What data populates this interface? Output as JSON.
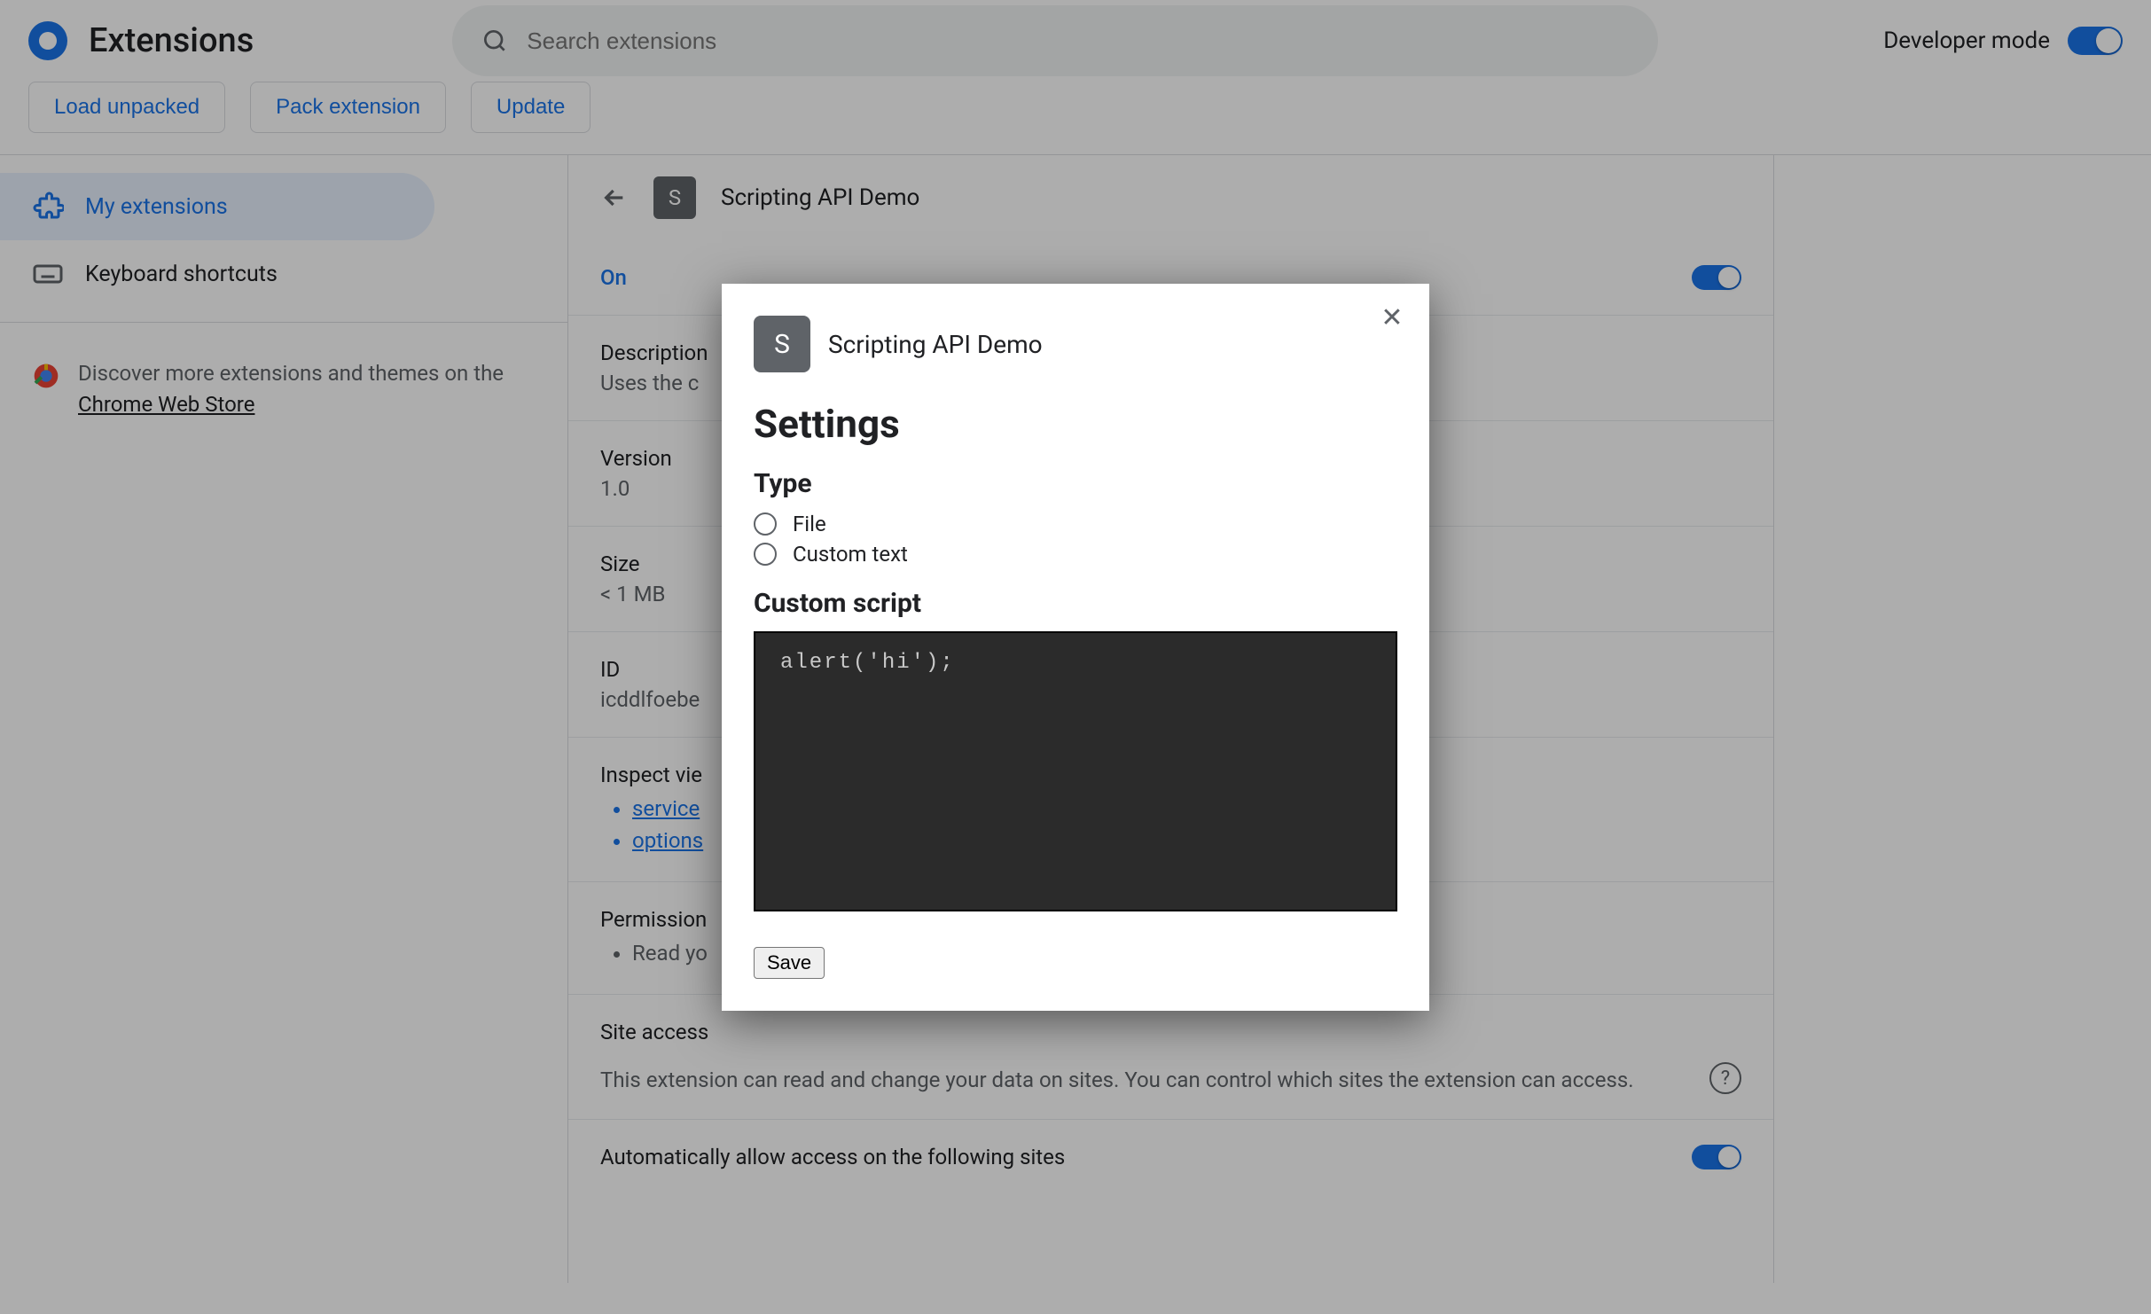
{
  "header": {
    "page_title": "Extensions",
    "search_placeholder": "Search extensions",
    "dev_mode_label": "Developer mode"
  },
  "toolbar": {
    "load_unpacked": "Load unpacked",
    "pack_extension": "Pack extension",
    "update": "Update"
  },
  "sidebar": {
    "my_extensions": "My extensions",
    "keyboard_shortcuts": "Keyboard shortcuts",
    "promo_prefix": "Discover more extensions and themes on the ",
    "promo_link": "Chrome Web Store"
  },
  "detail": {
    "title": "Scripting API Demo",
    "badge_letter": "S",
    "on_label": "On",
    "description_label": "Description",
    "description_value": "Uses the c",
    "version_label": "Version",
    "version_value": "1.0",
    "size_label": "Size",
    "size_value": "< 1 MB",
    "id_label": "ID",
    "id_value": "icddlfoebe",
    "inspect_label": "Inspect vie",
    "inspect_items": [
      "service",
      "options"
    ],
    "permissions_label": "Permission",
    "permissions_items": [
      "Read yo"
    ],
    "site_access_label": "Site access",
    "site_access_desc": "This extension can read and change your data on sites. You can control which sites the extension can access.",
    "auto_allow_label": "Automatically allow access on the following sites"
  },
  "modal": {
    "badge_letter": "S",
    "ext_title": "Scripting API Demo",
    "heading": "Settings",
    "type_heading": "Type",
    "radio_file": "File",
    "radio_custom": "Custom text",
    "script_heading": "Custom script",
    "script_value": "alert('hi');",
    "save_label": "Save"
  }
}
